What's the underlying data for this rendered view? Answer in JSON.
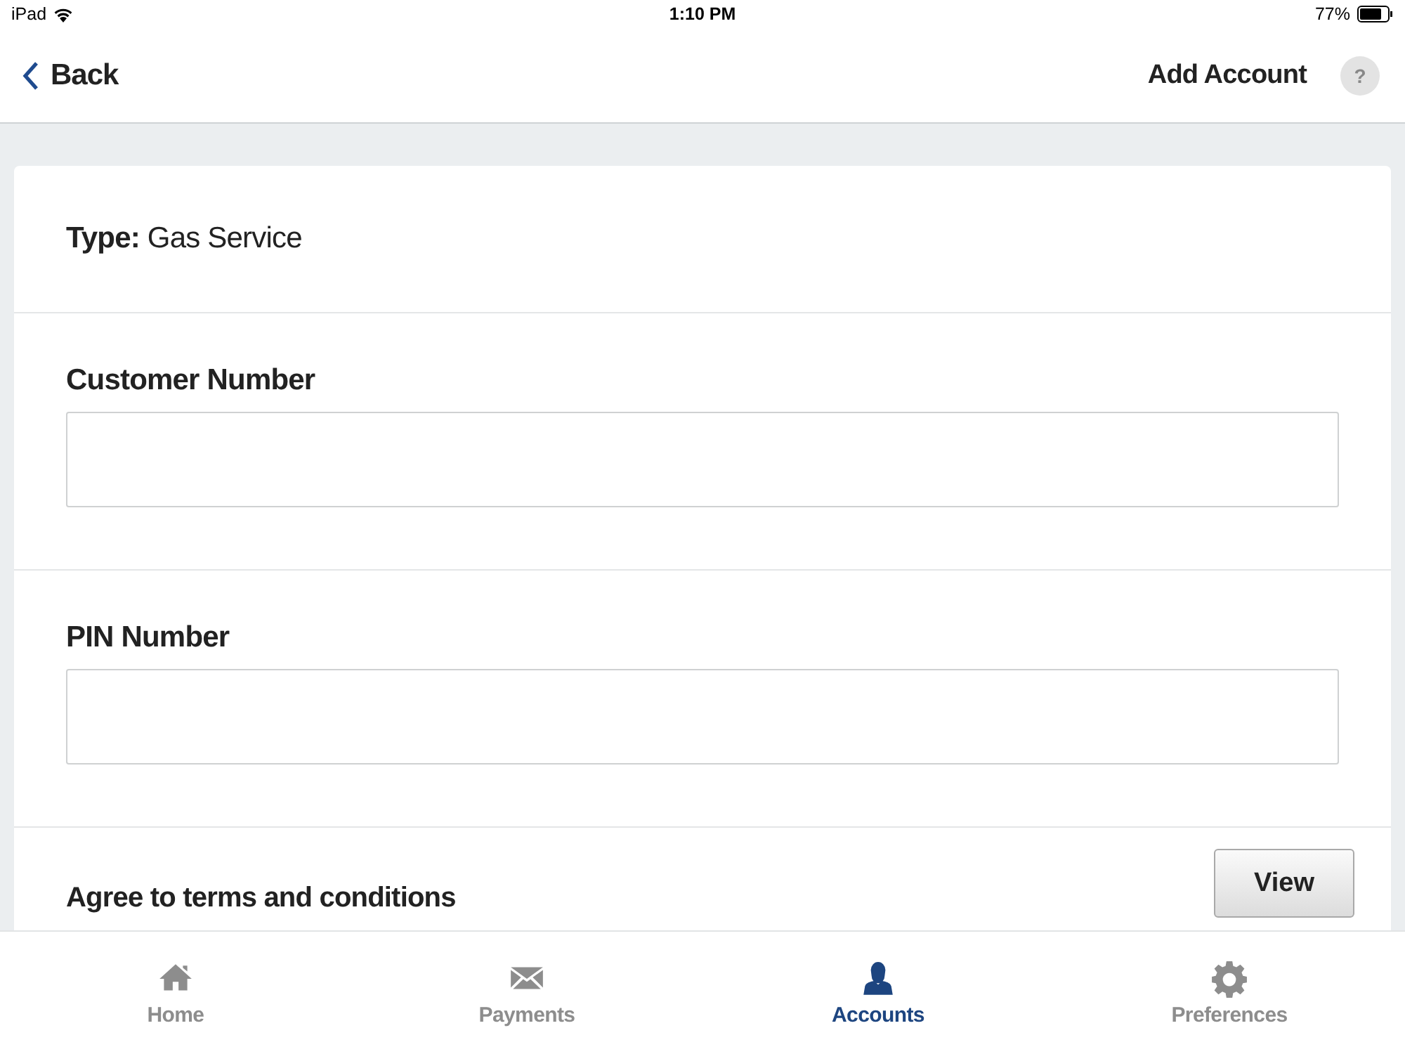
{
  "status_bar": {
    "device": "iPad",
    "time": "1:10 PM",
    "battery": "77%"
  },
  "nav_bar": {
    "back": "Back",
    "title": "Add Account",
    "help": "?"
  },
  "type_line": "**Type:** Gas Service",
  "fields": [
    {
      "label": "Customer Number"
    },
    {
      "label": "PIN Number"
    }
  ],
  "terms": {
    "label": "Agree to terms and conditions",
    "button": "View"
  },
  "tabs": [
    {
      "kind": "home",
      "label": "Home",
      "selected": false
    },
    {
      "kind": "mail",
      "label": "Payments",
      "selected": false
    },
    {
      "kind": "person",
      "label": "Accounts",
      "selected": true
    },
    {
      "kind": "gear",
      "label": "Preferences",
      "selected": false
    }
  ]
}
